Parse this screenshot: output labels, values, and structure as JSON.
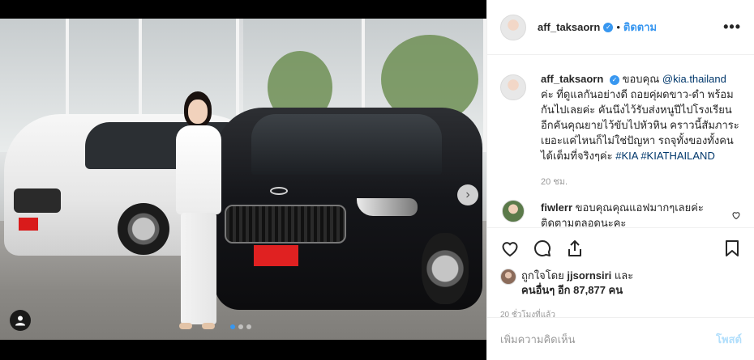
{
  "post": {
    "username": "aff_taksaorn",
    "separator": "•",
    "follow_label": "ติดตาม",
    "more_label": "•••"
  },
  "caption": {
    "username": "aff_taksaorn",
    "prefix": "ขอบคุณ ",
    "mention": "@kia.thailand",
    "text": " ค่ะ ที่ดูแลกันอย่างดี ถอยคุ่ผดขาว-ดำ พร้อมกันไปเลยค่ะ คันนึงไว้รับส่งหนูปีไปโรงเรียน อีกคันคุณยายไว้ขับไปหัวหิน คราวนี้สัมภาระเยอะแค่ไหนก็ไม่ใช่ปัญหา รถจุทั้งของทั้งคนได้เต็มที่จริงๆค่ะ ",
    "hashtag1": "#KIA",
    "hashtag2": "#KIATHAILAND",
    "time": "20 ชม."
  },
  "comment": {
    "username": "fiwlerr",
    "text": " ขอบคุณคุณแอฟมากๆเลยค่ะ ติดตามตลอดนะคะ"
  },
  "likes": {
    "prefix": "ถูกใจโดย ",
    "user": "jjsornsiri",
    "middle": " และ",
    "others_label": "คนอื่นๆ อีก 87,877 คน"
  },
  "timestamp": "20 ชั่วโมงที่แล้ว",
  "add_comment": {
    "placeholder": "เพิ่มความคิดเห็น",
    "post_label": "โพสต์"
  },
  "carousel": {
    "total": 3,
    "active": 1
  },
  "icons": {
    "verified": "verified-badge-icon",
    "heart": "heart-icon",
    "comment": "comment-icon",
    "share": "share-icon",
    "save": "bookmark-icon",
    "next": "chevron-right-icon",
    "user_tag": "user-tag-icon"
  },
  "colors": {
    "accent": "#3897f0",
    "text": "#262626",
    "muted": "#999999"
  }
}
